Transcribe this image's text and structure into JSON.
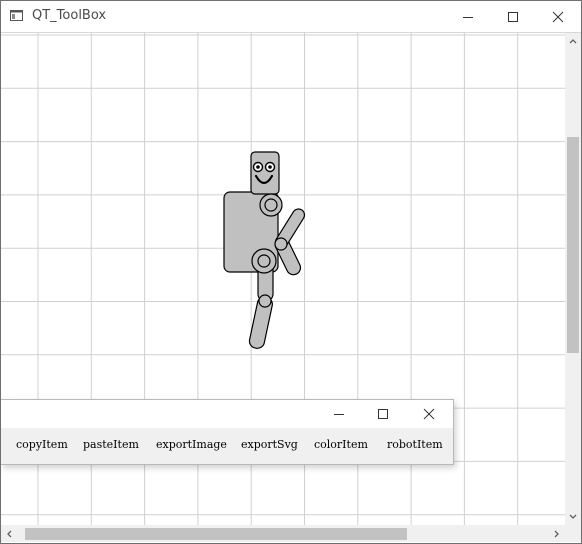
{
  "window": {
    "title": "QT_ToolBox",
    "minimize_icon": "minimize-icon",
    "maximize_icon": "maximize-icon",
    "close_icon": "close-icon"
  },
  "canvas": {
    "background": "#ffffff",
    "grid_color": "#d0d0d0",
    "robot_fill": "#c0c0c0",
    "robot_stroke": "#000000"
  },
  "toolbox": {
    "buttons": [
      {
        "label": "copyItem"
      },
      {
        "label": "pasteItem"
      },
      {
        "label": "exportImage"
      },
      {
        "label": "exportSvg"
      },
      {
        "label": "colorItem"
      },
      {
        "label": "robotItem"
      }
    ]
  }
}
